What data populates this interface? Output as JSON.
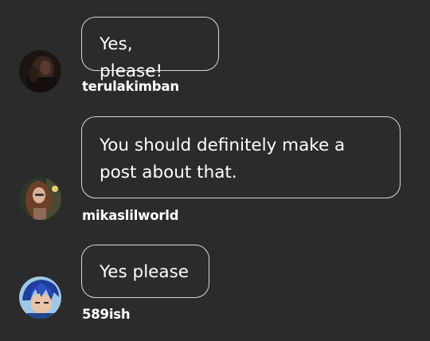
{
  "replies": [
    {
      "username": "terulakimban",
      "message": "Yes, please!",
      "avatar": "dark-portrait-avatar"
    },
    {
      "username": "mikaslilworld",
      "message": "You should definitely make a post about that.",
      "avatar": "woman-long-hair-avatar"
    },
    {
      "username": "589ish",
      "message": "Yes please",
      "avatar": "blue-hair-anime-avatar"
    }
  ],
  "colors": {
    "background": "#2b2b2b",
    "bubble_border": "#d8d8d8",
    "text": "#ffffff"
  }
}
